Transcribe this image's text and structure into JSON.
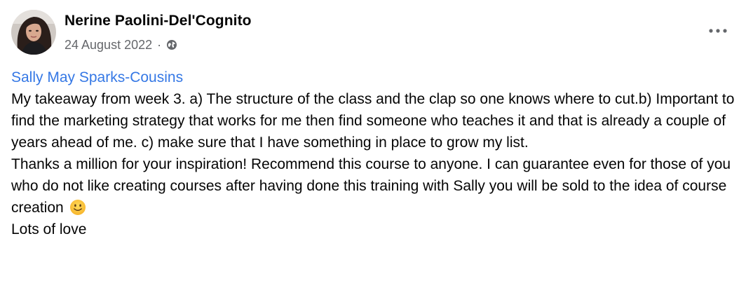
{
  "post": {
    "author": "Nerine Paolini-Del'Cognito",
    "date": "24 August 2022",
    "separator": "·",
    "privacy_icon": "globe-icon",
    "menu_icon": "more-horizontal-icon",
    "mention": "Sally May Sparks-Cousins",
    "paragraphs": [
      "My takeaway from week 3. a) The structure of the class and the clap so one knows where to cut.b) Important to find the marketing strategy that works for me then find someone who teaches it and that is already a couple of years ahead of me. c) make sure that I have something in place to grow my list.",
      "Thanks a million for your inspiration! Recommend this course to anyone. I can guarantee even for those of you who do not like creating courses after having done this training with Sally you will be sold to the idea of course creation",
      "Lots of love"
    ],
    "emoji_icon": "slightly-smiling-face-icon"
  },
  "colors": {
    "text": "#050505",
    "secondary_text": "#65676b",
    "link": "#3578e5",
    "background": "#ffffff"
  }
}
